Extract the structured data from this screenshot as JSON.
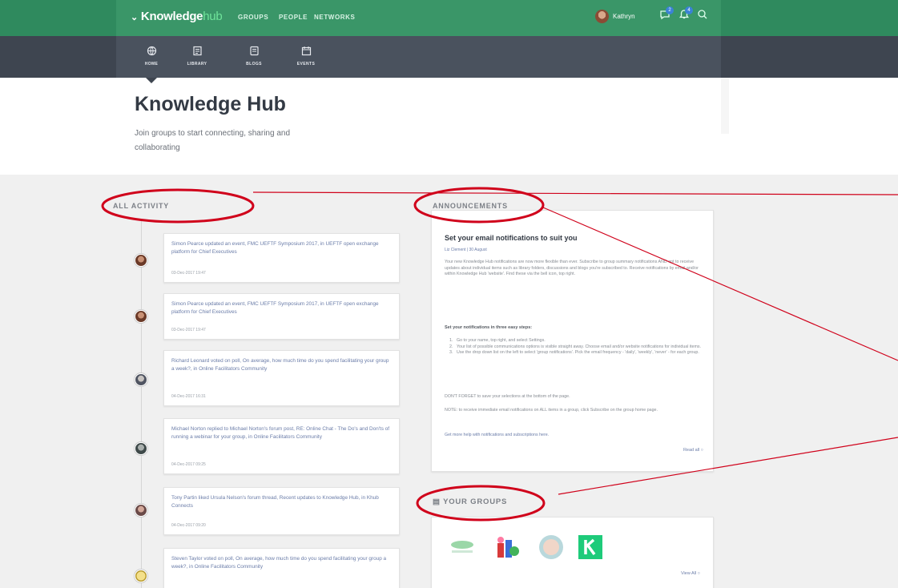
{
  "header": {
    "brand_name": "Knowledge",
    "brand_suffix": "hub",
    "nav": [
      "GROUPS",
      "PEOPLE",
      "NETWORKS"
    ],
    "user_name": "Kathryn",
    "messages_count": "2",
    "notifications_count": "4"
  },
  "subnav": [
    {
      "label": "HOME",
      "icon": "globe-icon"
    },
    {
      "label": "LIBRARY",
      "icon": "library-icon"
    },
    {
      "label": "BLOGS",
      "icon": "blog-icon"
    },
    {
      "label": "EVENTS",
      "icon": "calendar-icon"
    }
  ],
  "page": {
    "title": "Knowledge Hub",
    "tagline": "Join groups to start connecting, sharing and collaborating"
  },
  "activity": {
    "heading": "ALL ACTIVITY",
    "items": [
      {
        "text": "Simon Pearce updated an event, FMC UEFTF Symposium 2017, in UEFTF open exchange platform for Chief Executives",
        "date": "03-Dec-2017 19:47"
      },
      {
        "text": "Simon Pearce updated an event, FMC UEFTF Symposium 2017, in UEFTF open exchange platform for Chief Executives",
        "date": "03-Dec-2017 19:47"
      },
      {
        "text": "Richard Leonard voted on poll, On average, how much time do you spend facilitating your group a week?, in Online Facilitators Community",
        "date": "04-Dec-2017 16:31"
      },
      {
        "text": "Michael Norton replied to Michael Norton's forum post, RE: Online Chat - The Do's and Don'ts of running a webinar for your group, in Online Facilitators Community",
        "date": "04-Dec-2017 09:25"
      },
      {
        "text": "Tony Partin liked Ursula Nelson's forum thread, Recent updates to Knowledge Hub, in Khub Connects",
        "date": "04-Dec-2017 09:20"
      },
      {
        "text": "Steven Taylor voted on poll, On average, how much time do you spend facilitating your group a week?, in Online Facilitators Community",
        "date": ""
      }
    ]
  },
  "announcements": {
    "heading": "ANNOUNCEMENTS",
    "title": "Set your email notifications to suit you",
    "meta": "Liz Clement | 30 August",
    "intro": "Your new Knowledge Hub notifications are now more flexible than ever. Subscribe to group summary notifications AND opt to receive updates about individual items such as library folders, discussions and blogs you're subscribed to. Receive notifications by email and/or within Knowledge Hub 'website'. Find these via the bell icon, top right.",
    "steps_heading": "Set your notifications in three easy steps:",
    "steps": [
      "Go to your name, top right, and select Settings.",
      "Your list of possible communications options is visible straight away. Choose email and/or website notifications for individual items.",
      "Use the drop down list on the left to select 'group notifications'. Pick the email frequency - 'daily', 'weekly', 'never' - for each group."
    ],
    "dont_forget": "DON'T FORGET to save your selections at the bottom of the page.",
    "note": "NOTE: to receive immediate email notifications on ALL items in a group, click Subscribe on the group home page.",
    "help_link": "Get more help with notifications and subscriptions here.",
    "read_all": "Read all"
  },
  "groups": {
    "heading": "YOUR GROUPS",
    "view_all": "View All"
  },
  "colors": {
    "topbar": "#2f8a5e",
    "subnav": "#3e4550",
    "annotation": "#d0021b",
    "accent": "#1ecb7a"
  }
}
